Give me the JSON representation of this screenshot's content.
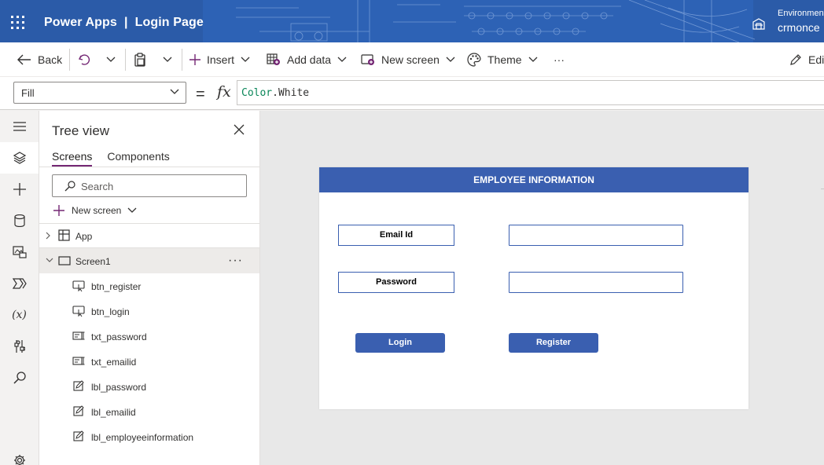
{
  "header": {
    "app_name": "Power Apps",
    "separator": "|",
    "page_name": "Login Page",
    "environment_label": "Environment",
    "environment_value": "crmonce"
  },
  "command_bar": {
    "back": "Back",
    "insert": "Insert",
    "add_data": "Add data",
    "new_screen": "New screen",
    "theme": "Theme",
    "more": "···",
    "edit": "Edi"
  },
  "formula_bar": {
    "property": "Fill",
    "equals": "=",
    "fx": "fx",
    "formula_object": "Color",
    "formula_member": ".White"
  },
  "tree_view": {
    "title": "Tree view",
    "tabs": [
      "Screens",
      "Components"
    ],
    "search_placeholder": "Search",
    "new_screen": "New screen",
    "nodes": {
      "app": "App",
      "screen": "Screen1",
      "children": [
        {
          "label": "btn_register",
          "kind": "button"
        },
        {
          "label": "btn_login",
          "kind": "button"
        },
        {
          "label": "txt_password",
          "kind": "text-input"
        },
        {
          "label": "txt_emailid",
          "kind": "text-input"
        },
        {
          "label": "lbl_password",
          "kind": "label"
        },
        {
          "label": "lbl_emailid",
          "kind": "label"
        },
        {
          "label": "lbl_employeeinformation",
          "kind": "label"
        }
      ]
    }
  },
  "canvas": {
    "header_text": "EMPLOYEE INFORMATION",
    "email_label": "Email Id",
    "password_label": "Password",
    "email_value": "",
    "password_value": "",
    "login_button": "Login",
    "register_button": "Register"
  },
  "colors": {
    "header_bg": "#2b5ba8",
    "brand_purple": "#742774",
    "app_accent": "#3a5fb0",
    "canvas_bg": "#e8e8e8"
  }
}
